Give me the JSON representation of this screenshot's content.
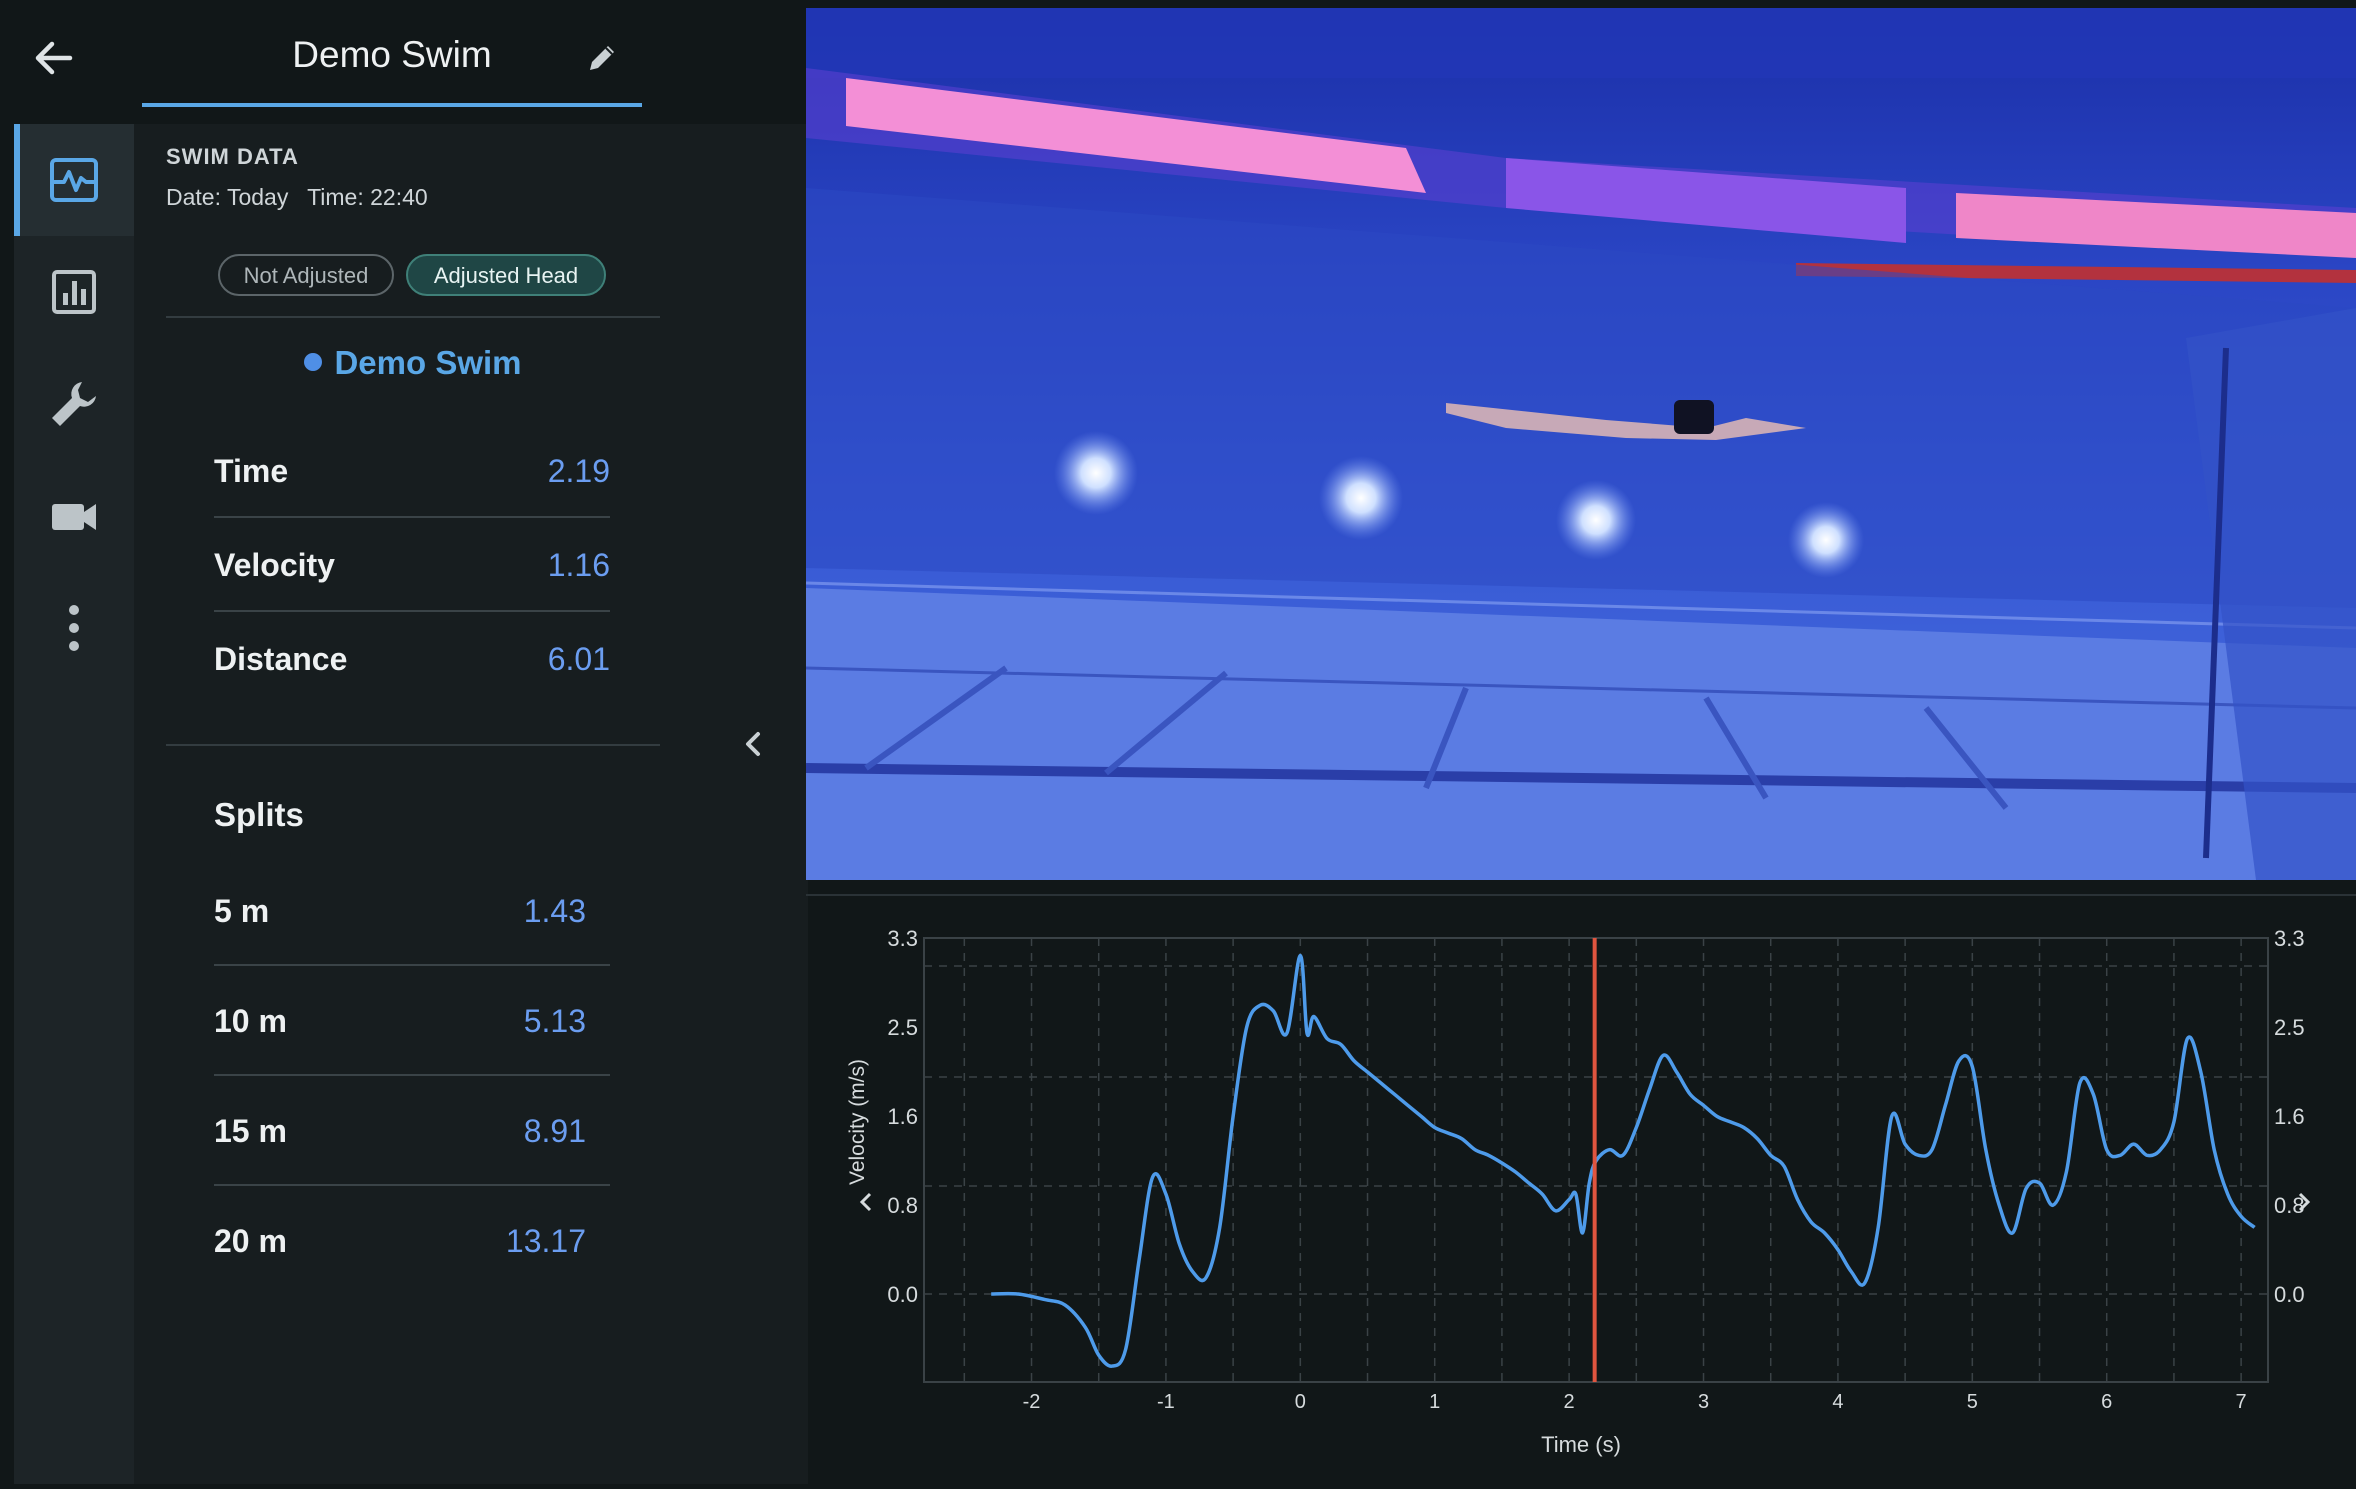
{
  "header": {
    "title": "Demo Swim"
  },
  "panel": {
    "section_label": "SWIM DATA",
    "meta": "Date: Today   Time: 22:40",
    "toggles": [
      "Not Adjusted",
      "Adjusted Head"
    ],
    "session_name": "Demo Swim",
    "metrics": [
      {
        "label": "Time",
        "value": "2.19"
      },
      {
        "label": "Velocity",
        "value": "1.16"
      },
      {
        "label": "Distance",
        "value": "6.01"
      }
    ],
    "splits_title": "Splits",
    "splits": [
      {
        "label": "5 m",
        "value": "1.43"
      },
      {
        "label": "10 m",
        "value": "5.13"
      },
      {
        "label": "15 m",
        "value": "8.91"
      },
      {
        "label": "20 m",
        "value": "13.17"
      }
    ]
  },
  "icons": {
    "back": "arrow-left-icon",
    "edit": "pencil-icon",
    "rail": [
      "pulse-chart-icon",
      "bar-chart-icon",
      "wrench-icon",
      "video-camera-icon",
      "more-vertical-icon"
    ],
    "collapse": "chevron-left-icon"
  },
  "colors": {
    "accent": "#5aa7e6",
    "value": "#6b9df0",
    "series": "#4e9bea",
    "cursor": "#e0553f"
  },
  "chart_data": {
    "type": "line",
    "title": "",
    "xlabel": "Time (s)",
    "ylabel": "Velocity (m/s)",
    "xlim": [
      -2.8,
      7.2
    ],
    "ylim": [
      -0.8,
      3.3
    ],
    "xticks": [
      "-2",
      "-1",
      "0",
      "1",
      "2",
      "3",
      "4",
      "5",
      "6",
      "7"
    ],
    "yticks": [
      "3.3",
      "2.5",
      "1.6",
      "0.8",
      "0.0"
    ],
    "grid": true,
    "cursor_x": 2.19,
    "series": [
      {
        "x": [
          -2.3,
          -2.1,
          -1.9,
          -1.75,
          -1.6,
          -1.5,
          -1.4,
          -1.3,
          -1.2,
          -1.1,
          -1.0,
          -0.9,
          -0.8,
          -0.7,
          -0.6,
          -0.5,
          -0.4,
          -0.3,
          -0.2,
          -0.1,
          0.0,
          0.05,
          0.1,
          0.2,
          0.3,
          0.4,
          0.5,
          0.6,
          0.7,
          0.8,
          0.9,
          1.0,
          1.1,
          1.2,
          1.3,
          1.4,
          1.5,
          1.6,
          1.7,
          1.8,
          1.9,
          2.0,
          2.05,
          2.1,
          2.15,
          2.2,
          2.3,
          2.4,
          2.5,
          2.6,
          2.7,
          2.8,
          2.9,
          3.0,
          3.1,
          3.2,
          3.3,
          3.4,
          3.5,
          3.6,
          3.7,
          3.8,
          3.9,
          4.0,
          4.1,
          4.2,
          4.3,
          4.4,
          4.5,
          4.6,
          4.7,
          4.8,
          4.9,
          5.0,
          5.1,
          5.2,
          5.3,
          5.4,
          5.5,
          5.6,
          5.7,
          5.8,
          5.9,
          6.0,
          6.1,
          6.2,
          6.3,
          6.4,
          6.5,
          6.6,
          6.7,
          6.8,
          6.9,
          7.0,
          7.1
        ],
        "y": [
          0.0,
          0.0,
          -0.05,
          -0.1,
          -0.3,
          -0.55,
          -0.65,
          -0.5,
          0.3,
          1.05,
          0.9,
          0.45,
          0.2,
          0.15,
          0.6,
          1.6,
          2.4,
          2.6,
          2.55,
          2.35,
          3.05,
          2.35,
          2.5,
          2.3,
          2.25,
          2.1,
          2.0,
          1.9,
          1.8,
          1.7,
          1.6,
          1.5,
          1.45,
          1.4,
          1.3,
          1.25,
          1.18,
          1.1,
          1.0,
          0.9,
          0.75,
          0.85,
          0.9,
          0.55,
          1.0,
          1.2,
          1.3,
          1.25,
          1.5,
          1.85,
          2.15,
          2.0,
          1.8,
          1.7,
          1.6,
          1.55,
          1.5,
          1.4,
          1.25,
          1.15,
          0.85,
          0.65,
          0.55,
          0.4,
          0.2,
          0.1,
          0.6,
          1.6,
          1.35,
          1.25,
          1.3,
          1.7,
          2.1,
          2.05,
          1.3,
          0.8,
          0.55,
          0.95,
          1.0,
          0.8,
          1.1,
          1.9,
          1.8,
          1.3,
          1.25,
          1.35,
          1.25,
          1.3,
          1.55,
          2.3,
          2.0,
          1.3,
          0.9,
          0.7,
          0.6
        ]
      }
    ]
  }
}
